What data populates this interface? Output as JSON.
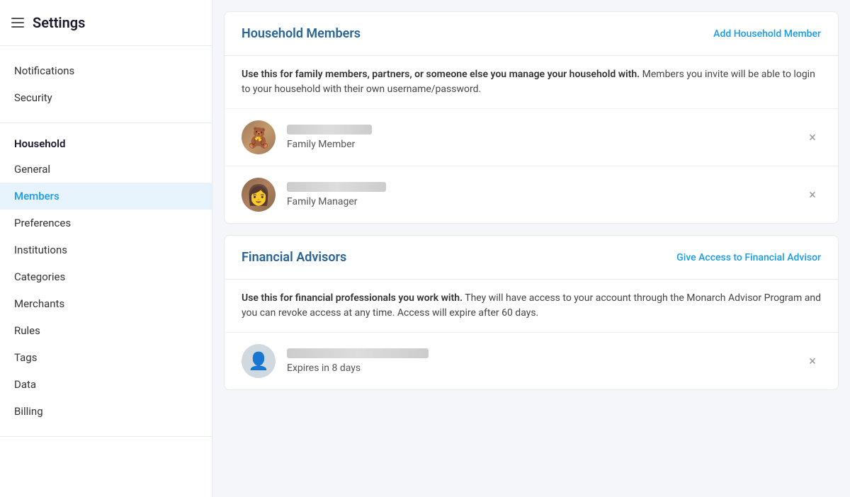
{
  "sidebar": {
    "title": "Settings",
    "top_items": [
      {
        "id": "notifications",
        "label": "Notifications"
      },
      {
        "id": "security",
        "label": "Security"
      }
    ],
    "household_section_label": "Household",
    "household_items": [
      {
        "id": "general",
        "label": "General"
      },
      {
        "id": "members",
        "label": "Members",
        "active": true
      },
      {
        "id": "preferences",
        "label": "Preferences"
      },
      {
        "id": "institutions",
        "label": "Institutions"
      },
      {
        "id": "categories",
        "label": "Categories"
      },
      {
        "id": "merchants",
        "label": "Merchants"
      },
      {
        "id": "rules",
        "label": "Rules"
      },
      {
        "id": "tags",
        "label": "Tags"
      },
      {
        "id": "data",
        "label": "Data"
      },
      {
        "id": "billing",
        "label": "Billing"
      }
    ]
  },
  "household_members": {
    "title": "Household Members",
    "action_label": "Add Household Member",
    "description_bold": "Use this for family members, partners, or someone else you manage your household with.",
    "description_rest": " Members you invite will be able to login to your household with their own username/password.",
    "members": [
      {
        "id": "member1",
        "avatar_type": "bear",
        "name_blur_width": 110,
        "role": "Family Member"
      },
      {
        "id": "member2",
        "avatar_type": "woman",
        "name_blur_width": 140,
        "role": "Family Manager"
      }
    ]
  },
  "financial_advisors": {
    "title": "Financial Advisors",
    "action_label": "Give Access to Financial Advisor",
    "description_bold": "Use this for financial professionals you work with.",
    "description_rest": " They will have access to your account through the Monarch Advisor Program and you can revoke access at any time. Access will expire after 60 days.",
    "advisors": [
      {
        "id": "advisor1",
        "avatar_type": "blank",
        "name_blur_width": 200,
        "expires": "Expires in 8 days"
      }
    ]
  },
  "icons": {
    "close": "×",
    "hamburger": "☰"
  }
}
